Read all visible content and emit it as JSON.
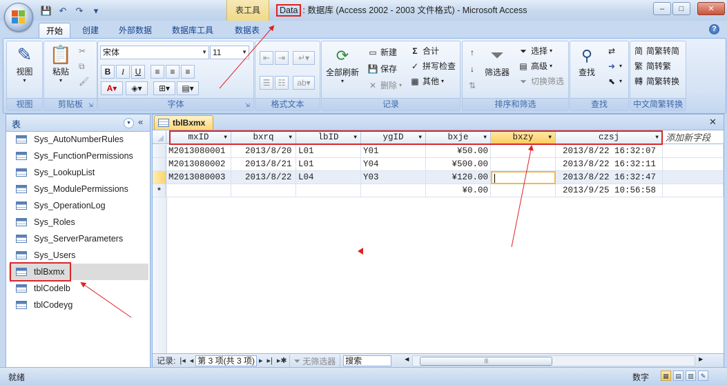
{
  "window": {
    "context_tab": "表工具",
    "title_highlight": "Data",
    "title_rest": ": 数据库 (Access 2002 - 2003 文件格式) - Microsoft Access",
    "minimize": "–",
    "maximize": "□",
    "close": "✕"
  },
  "quick_access": [
    "save-icon",
    "undo-icon",
    "redo-icon",
    "customize-icon"
  ],
  "ribbon_tabs": [
    "开始",
    "创建",
    "外部数据",
    "数据库工具",
    "数据表"
  ],
  "ribbon": {
    "view": {
      "label": "视图",
      "group": "视图"
    },
    "clipboard": {
      "paste": "粘贴",
      "group": "剪贴板"
    },
    "font": {
      "name": "宋体",
      "size": "11",
      "group": "字体",
      "bold": "B",
      "italic": "I",
      "underline": "U"
    },
    "rich_text": {
      "group": "格式文本"
    },
    "records": {
      "refresh": "全部刷新",
      "new": "新建",
      "save": "保存",
      "delete": "删除",
      "totals": "合计",
      "spelling": "拼写检查",
      "more": "其他",
      "group": "记录"
    },
    "sort_filter": {
      "filter": "筛选器",
      "selection": "选择",
      "advanced": "高级",
      "toggle": "切换筛选",
      "group": "排序和筛选"
    },
    "find": {
      "find": "查找",
      "group": "查找"
    },
    "chinese": {
      "to_trad": "简繁转简",
      "to_simp": "简转繁",
      "convert": "简繁转换",
      "group": "中文简繁转换"
    }
  },
  "nav": {
    "title": "表",
    "items": [
      "Sys_AutoNumberRules",
      "Sys_FunctionPermissions",
      "Sys_LookupList",
      "Sys_ModulePermissions",
      "Sys_OperationLog",
      "Sys_Roles",
      "Sys_ServerParameters",
      "Sys_Users",
      "tblBxmx",
      "tblCodelb",
      "tblCodeyg"
    ],
    "selected": "tblBxmx"
  },
  "document": {
    "tab": "tblBxmx",
    "columns": [
      "mxID",
      "bxrq",
      "lbID",
      "ygID",
      "bxje",
      "bxzy",
      "czsj"
    ],
    "add_field": "添加新字段",
    "rows": [
      [
        "M2013080001",
        "2013/8/20",
        "L01",
        "Y01",
        "¥50.00",
        "",
        "2013/8/22 16:32:07"
      ],
      [
        "M2013080002",
        "2013/8/21",
        "L01",
        "Y04",
        "¥500.00",
        "",
        "2013/8/22 16:32:11"
      ],
      [
        "M2013080003",
        "2013/8/22",
        "L04",
        "Y03",
        "¥120.00",
        "",
        "2013/8/22 16:32:47"
      ]
    ],
    "new_row": [
      "",
      "",
      "",
      "",
      "¥0.00",
      "",
      "2013/9/25 10:56:58"
    ],
    "new_row_marker": "*"
  },
  "record_nav": {
    "label": "记录:",
    "position": "第 3 项(共 3 项)",
    "filter": "无筛选器",
    "search": "搜索"
  },
  "status": {
    "left": "就绪",
    "mode": "数字"
  }
}
